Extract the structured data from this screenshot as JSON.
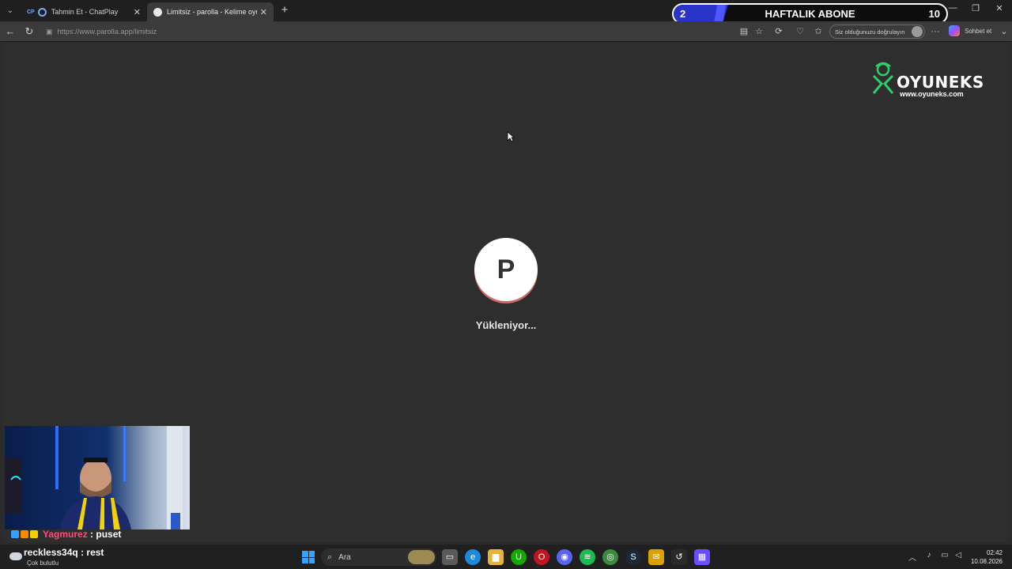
{
  "browser": {
    "tabs": [
      {
        "label": "Tahmin Et - ChatPlay",
        "prefix": "CP",
        "active": false
      },
      {
        "label": "Limitsiz - parolla - Kelime oyunu",
        "active": true
      }
    ],
    "url": "https://www.parolla.app/limitsiz",
    "verify_label": "Siz olduğunuzu doğrulayın",
    "copilot_label": "Sohbet et"
  },
  "overlay": {
    "current": "2",
    "label": "HAFTALIK ABONE",
    "goal": "10",
    "progress": 0.2,
    "accent": "#2b34c9"
  },
  "brand": {
    "name": "OYUNEKS",
    "site": "www.oyuneks.com",
    "color": "#2ecf6a"
  },
  "page": {
    "loader_letter": "P",
    "loading_text": "Yükleniyor..."
  },
  "chat": [
    {
      "user": "Yagmurez",
      "sep": " : ",
      "message": "puset",
      "user_color": "#ff4d7d"
    },
    {
      "user": "reckless34q",
      "sep": " : ",
      "message": "rest"
    }
  ],
  "taskbar": {
    "weather_desc": "Çok bulutlu",
    "search_placeholder": "Ara",
    "time": "02:42",
    "date": "10.08.2026",
    "apps": [
      "file-explorer-icon",
      "edge-icon",
      "folder-icon",
      "upwork-icon",
      "opera-icon",
      "discord-icon",
      "spotify-icon",
      "chrome-icon",
      "steam-icon",
      "mail-icon",
      "arrow-icon",
      "grid-app-icon"
    ]
  }
}
